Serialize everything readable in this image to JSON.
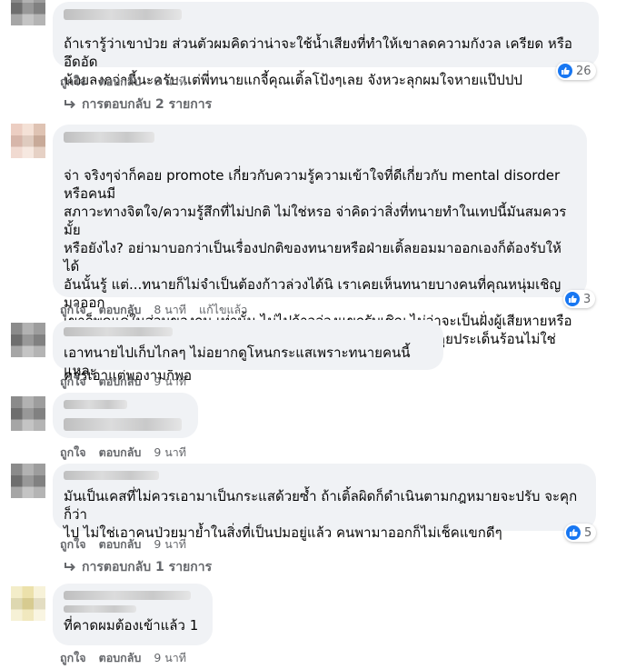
{
  "actions": {
    "like": "ถูกใจ",
    "reply": "ตอบกลับ",
    "edited": "แก้ไขแล้ว"
  },
  "comments": [
    {
      "text": "ถ้าเรารู้ว่าเขาป่วย ส่วนตัวผมคิดว่าน่าจะใช้น้ำเสียงที่ทำให้เขาลดความกังวล เครียด หรืออึดอัด\nน้อยลงกว่านี้นะครับ แต่พี่ทนายแกจี้คุณเติ้ลโป้งๆเลย จังหวะลุกผมใจหายแป๊ปปป",
      "time": "8 นาที",
      "reactions": "26",
      "replies": "การตอบกลับ 2 รายการ"
    },
    {
      "text": "จ่า จริงๆจ่าก็คอย promote เกี่ยวกับความรู้ความเข้าใจที่ดีเกี่ยวกับ mental disorder หรือคนมี\nสภาวะทางจิตใจ/ความรู้สึกที่ไม่ปกติ ไม่ใช่หรอ จ่าคิดว่าสิ่งที่ทนายทำในเทปนี้มันสมควรมั้ย\nหรือยังไง? อย่ามาบอกว่าเป็นเรื่องปกติของทนายหรือฝ่ายเติ้ลยอมมาออกเองก็ต้องรับให้ได้\nอันนั้นรู้ แต่...ทนายก็ไม่จำเป็นต้องก้าวล่วงได้นิ เราเคยเห็นทนายบางคนที่คุณหนุ่มเชิญมาออก\nเขาก็พูดแค่ในส่วนของกม.เท่านั้น ไม่ไปก้าวล่วงแขกรับเชิญ ไม่ว่าจะเป็นฝั่งผู้เสียหายหรือ\nจำเลย นั่นคือสิ่งที่ควรทำนะ เพราะยังไงนี่มันก็คือรายการสัม+พูดคุยประเด็นร้อนไม่ใช่ศาล ก็\nควรเอาแต่พองามก็พอ",
      "time": "8 นาที",
      "reactions": "3"
    },
    {
      "text": "เอาทนายไปเก็บไกลๆ ไม่อยากดูโหนกระแสเพราะทนายคนนี้แหละ",
      "time": "9 นาที"
    },
    {
      "text": "",
      "time": "9 นาที"
    },
    {
      "text": "มันเป็นเคสที่ไม่ควรเอามาเป็นกระแสด้วยซ้ำ ถ้าเติ้ลผิดก็ดำเนินตามกฎหมายจะปรับ จะคุก ก็ว่า\nไป ไม่ใช่เอาคนป่วยมาย้ำในสิ่งที่เป็นปมอยู่แล้ว คนพามาออกก็ไม่เช็คแขกดีๆ",
      "time": "9 นาที",
      "reactions": "5",
      "replies": "การตอบกลับ 1 รายการ"
    },
    {
      "text": "ที่คาดผมต้องเข้าแล้ว 1",
      "time": "9 นาที"
    }
  ],
  "colors": {
    "bubble": "#f0f2f5",
    "meta": "#65676b",
    "like": "#1877f2"
  },
  "icons": {
    "like": "thumbs-up-icon",
    "reply": "reply-arrow-icon"
  }
}
